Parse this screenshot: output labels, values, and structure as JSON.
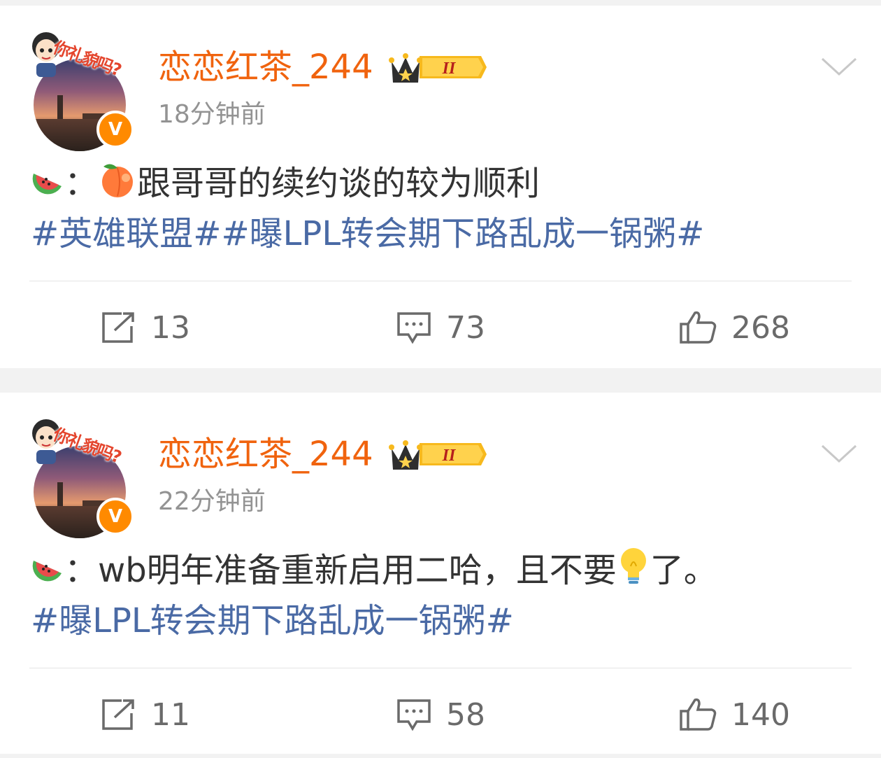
{
  "posts": [
    {
      "author": "恋恋红茶_244",
      "vip_level": "II",
      "time": "18分钟前",
      "content_colon": "：",
      "content_text": "跟哥哥的续约谈的较为顺利",
      "topics": "#英雄联盟##曝LPL转会期下路乱成一锅粥#",
      "emojis": [
        "watermelon-emoji",
        "peach-emoji"
      ],
      "reposts": "13",
      "comments": "73",
      "likes": "268"
    },
    {
      "author": "恋恋红茶_244",
      "vip_level": "II",
      "time": "22分钟前",
      "content_colon": "：",
      "content_text": "wb明年准备重新启用二哈，且不要",
      "content_text_after": "了。",
      "topics": "#曝LPL转会期下路乱成一锅粥#",
      "emojis": [
        "watermelon-emoji",
        "lightbulb-emoji"
      ],
      "reposts": "11",
      "comments": "58",
      "likes": "140"
    }
  ],
  "avatar_sticker_text": "你礼貌吗?",
  "verified_mark": "V",
  "colors": {
    "username": "#f0630e",
    "topic": "#4a6aa5",
    "meta": "#939393",
    "badge": "#ff8a00"
  }
}
